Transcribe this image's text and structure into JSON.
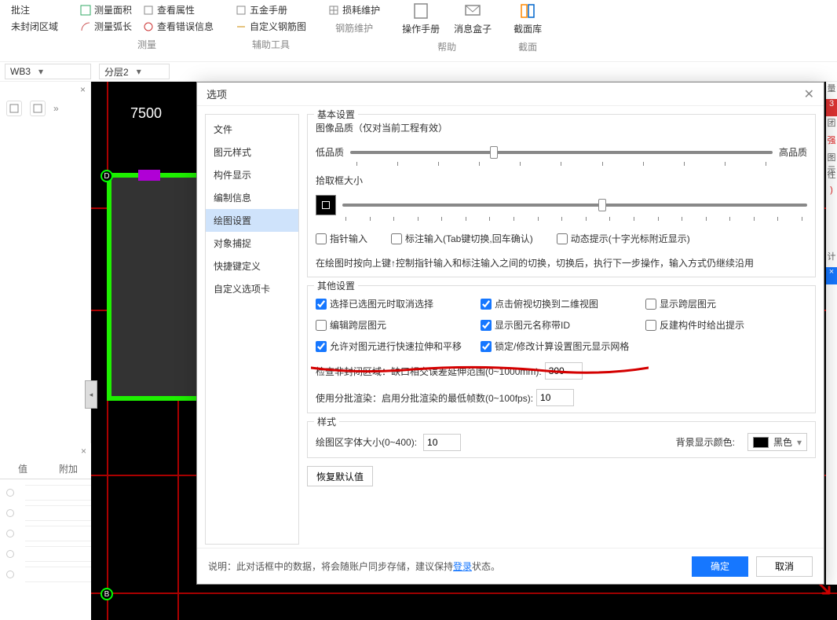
{
  "ribbon": {
    "annotate": "批注",
    "unclosed": "未封闭区域",
    "measure": {
      "area": "测量面积",
      "arc": "测量弧长",
      "attr": "查看属性",
      "err": "查看错误信息",
      "group": "测量"
    },
    "tool": {
      "hardware": "五金手册",
      "custom_rebar": "自定义钢筋图",
      "group": "辅助工具"
    },
    "rebar": {
      "loss": "损耗维护",
      "group": "钢筋维护"
    },
    "help": {
      "manual": "操作手册",
      "msgbox": "消息盒子",
      "group": "帮助"
    },
    "section": {
      "lib": "截面库",
      "group": "截面"
    }
  },
  "sel": {
    "type": "WB3",
    "floor": "分层2"
  },
  "canvas": {
    "dim": "7500",
    "node_d": "D",
    "node_b": "B"
  },
  "leftpanel2": {
    "tab1": "值",
    "tab2": "附加"
  },
  "dlg": {
    "title": "选项",
    "sidebar": [
      "文件",
      "图元样式",
      "构件显示",
      "编制信息",
      "绘图设置",
      "对象捕捉",
      "快捷键定义",
      "自定义选项卡"
    ],
    "active_index": 4,
    "basic": {
      "legend": "基本设置",
      "quality_label": "图像品质（仅对当前工程有效）",
      "low": "低品质",
      "high": "高品质",
      "pick_label": "拾取框大小",
      "chk_pointer": "指针输入",
      "chk_anno": "标注输入(Tab键切换,回车确认)",
      "chk_dyn": "动态提示(十字光标附近显示)",
      "note": "在绘图时按向上键↑控制指针输入和标注输入之间的切换，切换后，执行下一步操作，输入方式仍继续沿用"
    },
    "other": {
      "legend": "其他设置",
      "c1": "选择已选图元时取消选择",
      "c2": "点击俯视切换到二维视图",
      "c3": "显示跨层图元",
      "c4": "编辑跨层图元",
      "c5": "显示图元名称带ID",
      "c6": "反建构件时给出提示",
      "c7": "允许对图元进行快速拉伸和平移",
      "c8": "锁定/修改计算设置图元显示网格",
      "unclosed_label": "检查非封闭区域：缺口相交误差延伸范围(0~1000mm):",
      "unclosed_val": "300",
      "batch_label": "使用分批渲染：启用分批渲染的最低帧数(0~100fps):",
      "batch_val": "10"
    },
    "style": {
      "legend": "样式",
      "font_label": "绘图区字体大小(0~400):",
      "font_val": "10",
      "bg_label": "背景显示颜色:",
      "bg_val": "黑色"
    },
    "reset": "恢复默认值",
    "footer_prefix": "说明：此对话框中的数据，将会随账户同步存储，建议保持",
    "footer_link": "登录",
    "footer_suffix": "状态。",
    "ok": "确定",
    "cancel": "取消"
  },
  "rstrip": [
    "量",
    "3",
    "团",
    "强",
    "图示",
    "往",
    ")",
    "计",
    "×"
  ]
}
